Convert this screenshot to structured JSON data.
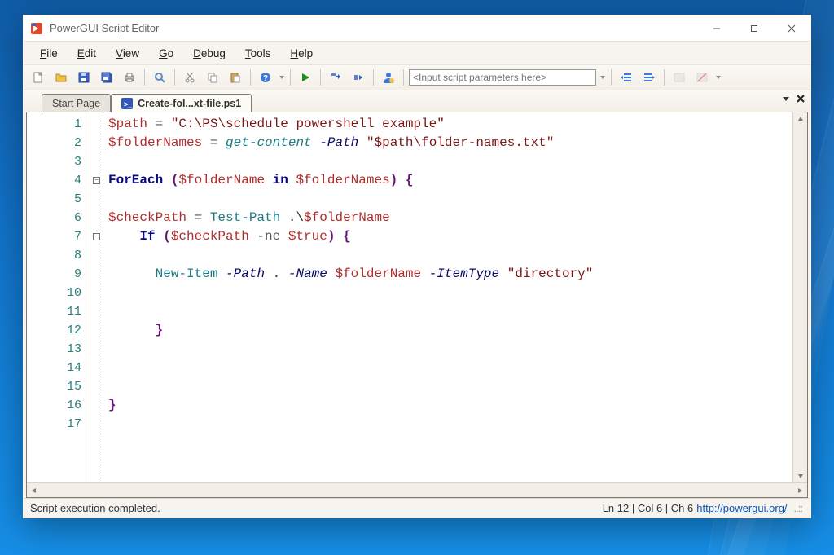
{
  "app": {
    "title": "PowerGUI Script Editor"
  },
  "menu": {
    "file": "File",
    "edit": "Edit",
    "view": "View",
    "go": "Go",
    "debug": "Debug",
    "tools": "Tools",
    "help": "Help"
  },
  "toolbar": {
    "script_params_placeholder": "<Input script parameters here>"
  },
  "tabs": {
    "start_page": "Start Page",
    "active": "Create-fol...xt-file.ps1"
  },
  "code": {
    "l1": {
      "var": "$path",
      "eq": " = ",
      "str": "\"C:\\PS\\schedule powershell example\""
    },
    "l2": {
      "var": "$folderNames",
      "eq": " = ",
      "cmd": "get-content",
      "par": "-Path",
      "str": "\"$path\\folder-names.txt\""
    },
    "l4": {
      "kw": "ForEach",
      "open": " (",
      "v1": "$folderName",
      "in": " in ",
      "v2": "$folderNames",
      "close": ")",
      "brace": " {"
    },
    "l6": {
      "var": "$checkPath",
      "eq": " = ",
      "cmd": "Test-Path",
      "arg": " .\\",
      "v2": "$folderName"
    },
    "l7": {
      "kw": "If",
      "open": " (",
      "v1": "$checkPath",
      "op": " -ne ",
      "v2": "$true",
      "close": ")",
      "brace": " {"
    },
    "l9": {
      "cmd": "New-Item",
      "p1": "-Path",
      "d1": " . ",
      "p2": "-Name",
      "v1": " $folderName ",
      "p3": "-ItemType",
      "str": " \"directory\""
    },
    "l12": {
      "brace": "}"
    },
    "l16": {
      "brace": "}"
    }
  },
  "status": {
    "message": "Script execution completed.",
    "pos": "Ln 12 | Col 6 | Ch 6",
    "link": "http://powergui.org/"
  }
}
